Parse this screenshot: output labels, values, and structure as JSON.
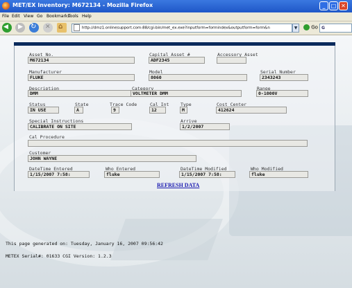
{
  "window": {
    "title": "MET/EX Inventory: M672134 - Mozilla Firefox"
  },
  "menu": [
    "File",
    "Edit",
    "View",
    "Go",
    "Bookmarks",
    "Tools",
    "Help"
  ],
  "address": {
    "url": "http://dmz1.onlinesupport.com:88/cgi-bin/met_ex.exe?inputform=formindex&outputform=form&n",
    "go_label": "Go",
    "search_label": "G"
  },
  "form": {
    "asset_no": {
      "label": "Asset No.",
      "value": "M672134"
    },
    "capital_asset": {
      "label": "Capital Asset #",
      "value": "ADF2345"
    },
    "accessory_asset": {
      "label": "Accessory Asset",
      "value": ""
    },
    "manufacturer": {
      "label": "Manufacturer",
      "value": "FLUKE"
    },
    "model": {
      "label": "Model",
      "value": "8060"
    },
    "serial_number": {
      "label": "Serial Number",
      "value": "2343243"
    },
    "description": {
      "label": "Description",
      "value": "DMM"
    },
    "category": {
      "label": "Category",
      "value": "VOLTMETER DMM"
    },
    "range": {
      "label": "Range",
      "value": "0-1000V"
    },
    "status": {
      "label": "Status",
      "value": "IN USE"
    },
    "state": {
      "label": "State",
      "value": "A"
    },
    "trace_code": {
      "label": "Trace Code",
      "value": "9"
    },
    "cal_int": {
      "label": "Cal Int",
      "value": "12"
    },
    "type": {
      "label": "Type",
      "value": "M"
    },
    "cost_center": {
      "label": "Cost Center",
      "value": "412624"
    },
    "special_instructions": {
      "label": "Special Instructions",
      "value": "CALIBRATE ON SITE"
    },
    "arrive": {
      "label": "Arrive",
      "value": "1/2/2007"
    },
    "cal_procedure": {
      "label": "Cal Procedure",
      "value": ""
    },
    "customer": {
      "label": "Customer",
      "value": "JOHN WAYNE"
    },
    "datetime_entered": {
      "label": "DateTime Entered",
      "value": "1/15/2007 7:58:"
    },
    "who_entered": {
      "label": "Who Entered",
      "value": "fluke"
    },
    "datetime_modified": {
      "label": "DateTime Modified",
      "value": "1/15/2007 7:58:"
    },
    "who_modified": {
      "label": "Who Modified",
      "value": "fluke"
    }
  },
  "refresh_label": "REFRESH DATA",
  "footer": {
    "generated": "This page generated on: Tuesday, January 16, 2007 09:56:42",
    "serial": "METEX  Serial#: 01633  CGI Version: 1.2.3"
  },
  "colors": {
    "titlebar": "#1f57c8",
    "header_bar": "#0a2a5c",
    "link": "#1a1ab0"
  }
}
